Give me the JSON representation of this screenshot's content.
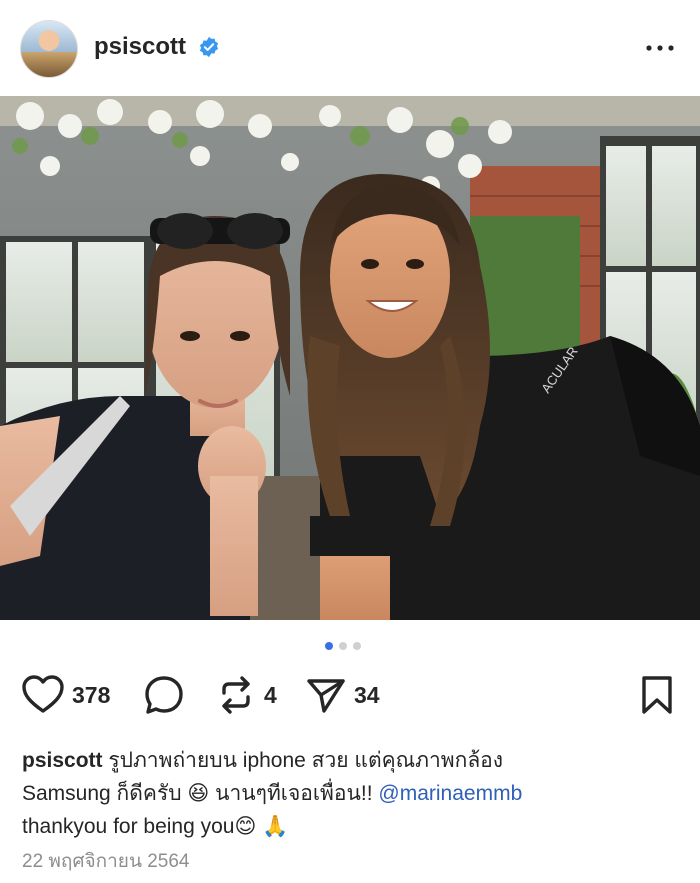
{
  "post": {
    "username": "psiscott",
    "verified": true,
    "photo_indicator": {
      "count": 3,
      "active_index": 0
    },
    "likes": "378",
    "comments": "",
    "reposts": "4",
    "shares": "34",
    "caption_user": "psiscott",
    "caption_line1": "รูปภาพถ่ายบน iphone สวย แต่คุณภาพกล้อง",
    "caption_line2_a": "Samsung ก็ดีครับ",
    "caption_emoji_laugh": "😆",
    "caption_line2_b": "นานๆทีเจอเพื่อน!!",
    "caption_mention": "@marinaemmb",
    "caption_line3": "thankyou for being you",
    "caption_emoji_smile": "😊",
    "caption_emoji_pray": "🙏",
    "date": "22 พฤศจิกายน 2564"
  },
  "icons": {
    "verified": "verified-badge-icon",
    "more": "more-options-icon",
    "like": "heart-icon",
    "comment": "comment-bubble-icon",
    "repost": "repost-icon",
    "share": "send-icon",
    "save": "bookmark-icon"
  },
  "colors": {
    "verified_blue": "#3897f0",
    "mention_blue": "#2f5fb8",
    "carousel_active": "#3b6fe5"
  }
}
